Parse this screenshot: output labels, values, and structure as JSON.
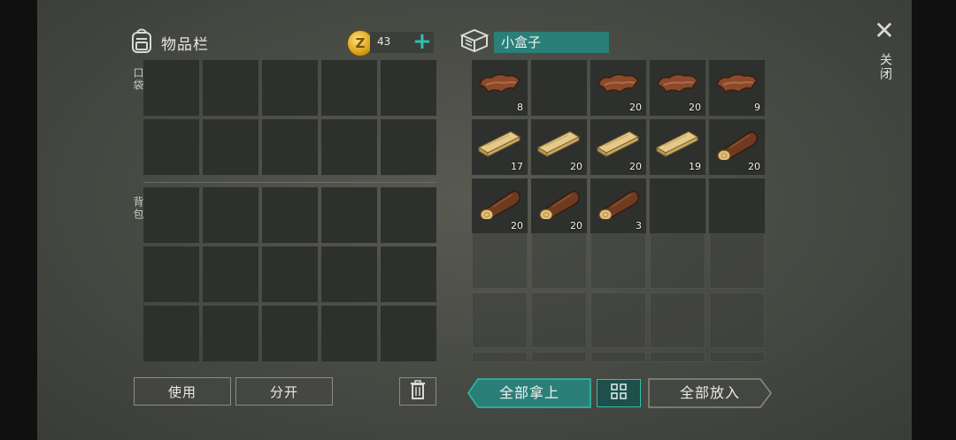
{
  "inventory": {
    "title": "物品栏",
    "coins": "43",
    "plus_label": "+",
    "pocket_label": "口袋",
    "backpack_label": "背包"
  },
  "container": {
    "name": "小盒子",
    "slots": [
      {
        "item": "leather",
        "qty": "8"
      },
      {
        "item": "",
        "qty": ""
      },
      {
        "item": "leather",
        "qty": "20"
      },
      {
        "item": "leather",
        "qty": "20"
      },
      {
        "item": "leather",
        "qty": "9"
      },
      {
        "item": "plank",
        "qty": "17"
      },
      {
        "item": "plank",
        "qty": "20"
      },
      {
        "item": "plank",
        "qty": "20"
      },
      {
        "item": "plank",
        "qty": "19"
      },
      {
        "item": "log",
        "qty": "20"
      },
      {
        "item": "log",
        "qty": "20"
      },
      {
        "item": "log",
        "qty": "20"
      },
      {
        "item": "log",
        "qty": "3"
      },
      {
        "item": "",
        "qty": ""
      },
      {
        "item": "",
        "qty": ""
      }
    ]
  },
  "close": {
    "label": "关闭",
    "icon": "close-icon"
  },
  "buttons": {
    "use": "使用",
    "split": "分开",
    "take_all": "全部拿上",
    "put_all": "全部放入"
  },
  "colors": {
    "accent": "#2fbfae",
    "box_name_bg": "#2a7f79",
    "slot": "#2e302d"
  }
}
